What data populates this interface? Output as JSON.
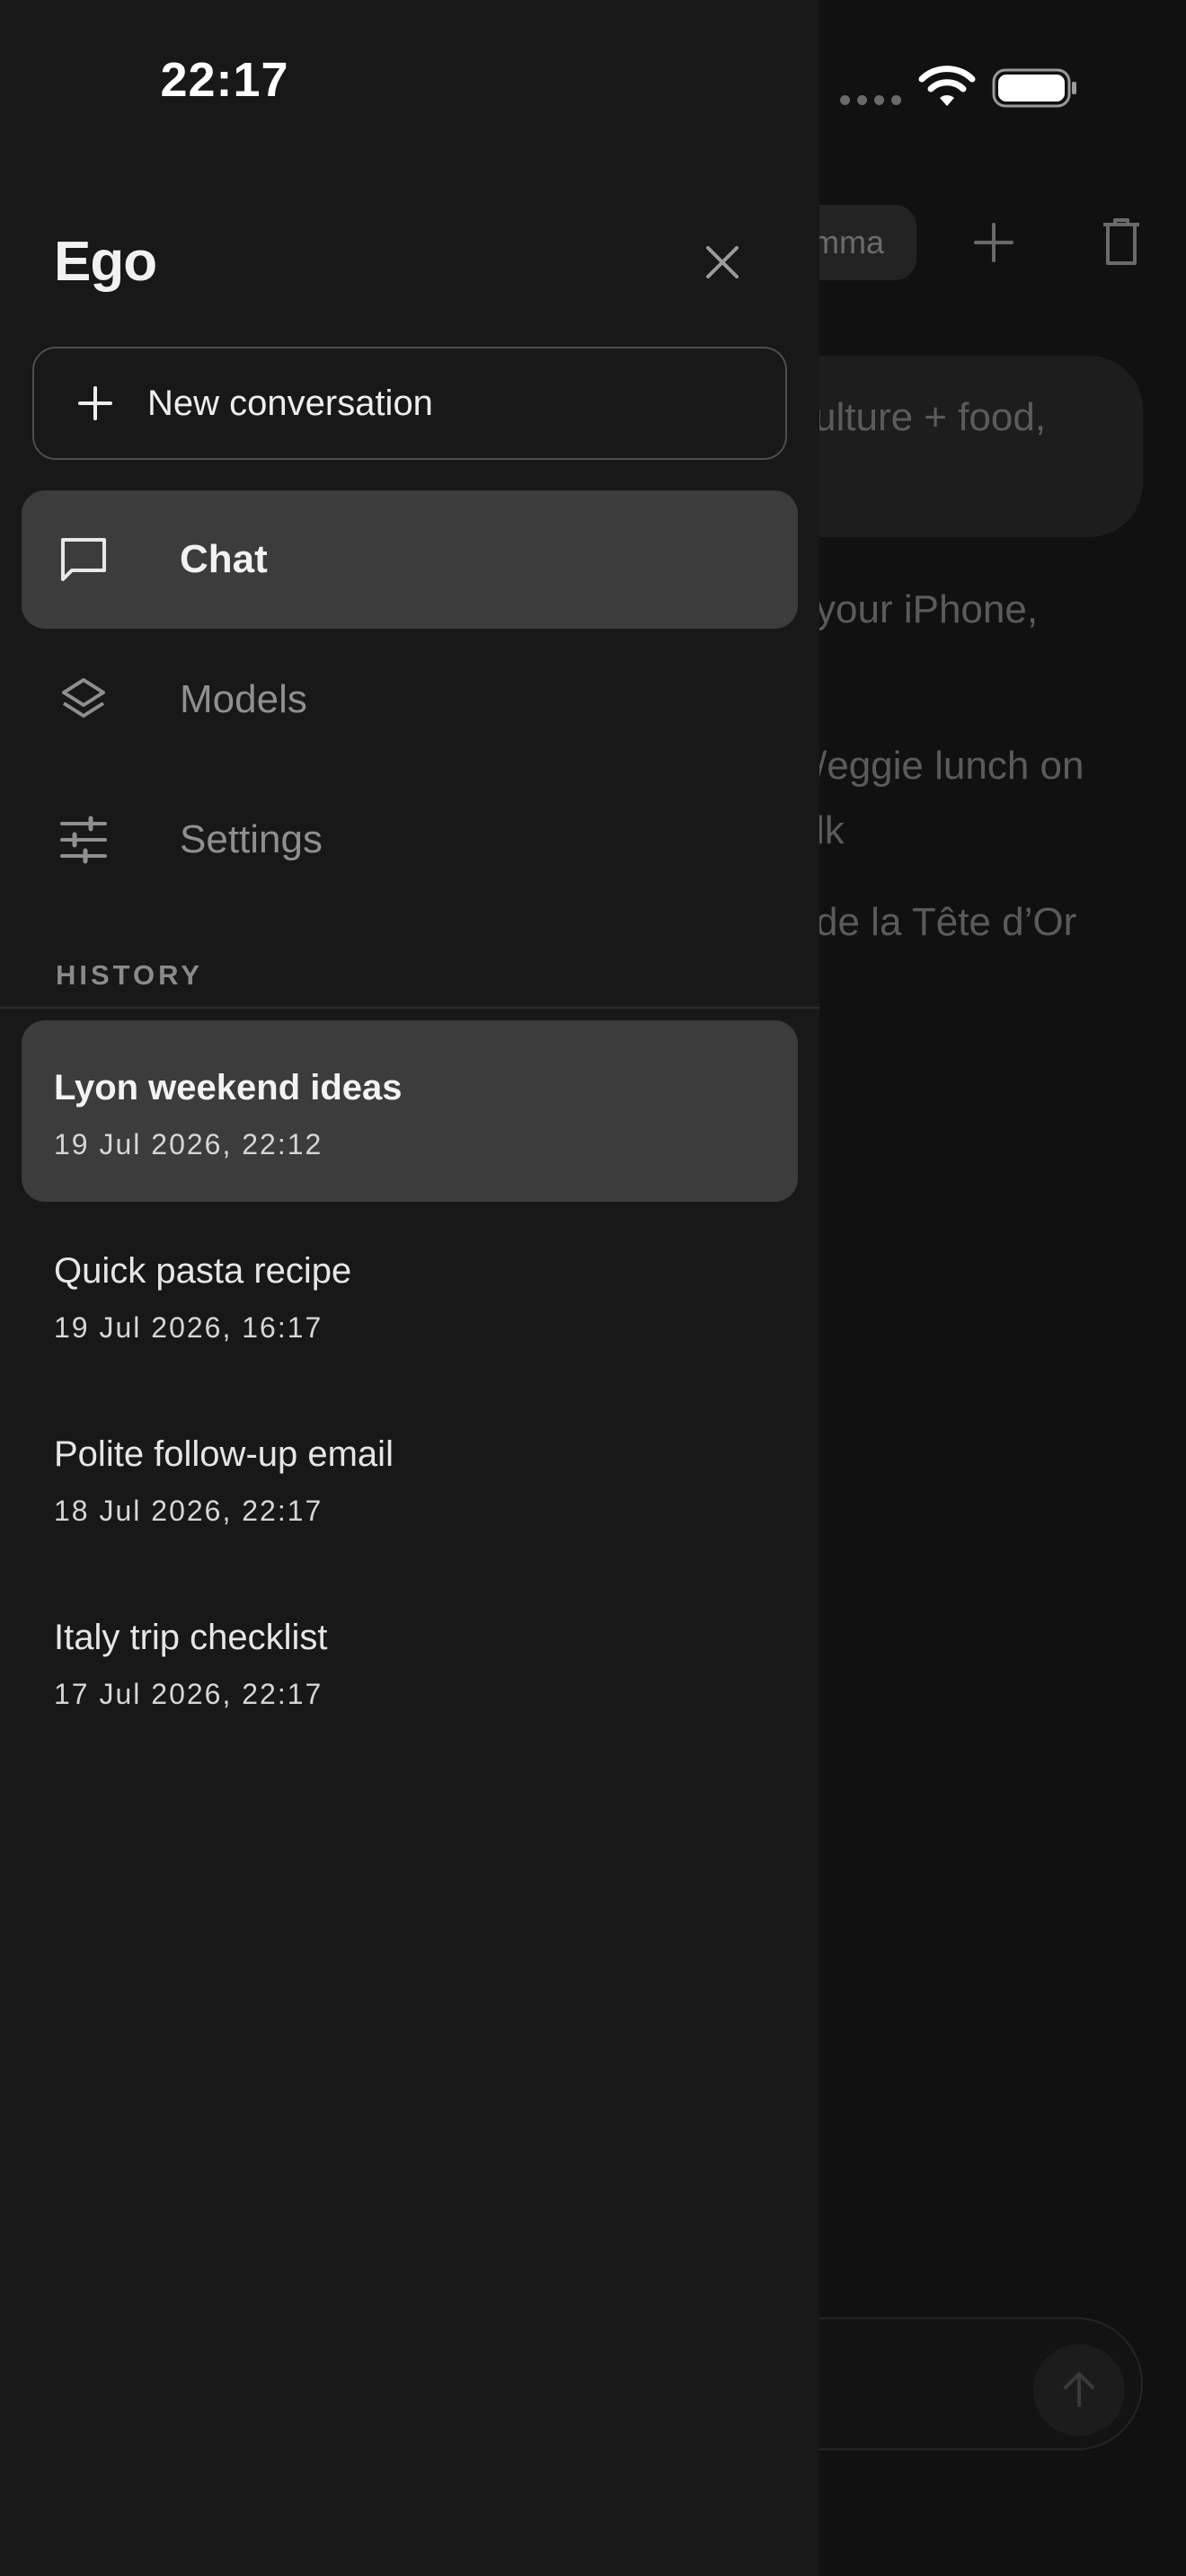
{
  "status_bar": {
    "time": "22:17"
  },
  "background_chat": {
    "model_chip_label": "mma",
    "user_message_fragment": "ulture + food,",
    "response_lines": [
      "your iPhone,",
      "/eggie lunch on",
      "lk",
      "de la Tête d’Or"
    ]
  },
  "drawer": {
    "title": "Ego",
    "new_conversation_label": "New conversation",
    "nav": [
      {
        "label": "Chat",
        "icon": "chat-bubble-icon",
        "active": true
      },
      {
        "label": "Models",
        "icon": "layers-icon",
        "active": false
      },
      {
        "label": "Settings",
        "icon": "sliders-icon",
        "active": false
      }
    ],
    "history_heading": "HISTORY",
    "history": [
      {
        "title": "Lyon weekend ideas",
        "date": "19 Jul 2026, 22:12",
        "active": true
      },
      {
        "title": "Quick pasta recipe",
        "date": "19 Jul 2026, 16:17",
        "active": false
      },
      {
        "title": "Polite follow-up email",
        "date": "18 Jul 2026, 22:17",
        "active": false
      },
      {
        "title": "Italy trip checklist",
        "date": "17 Jul 2026, 22:17",
        "active": false
      }
    ]
  },
  "colors": {
    "drawer_bg": "#181818",
    "active_item_bg": "#3c3c3c",
    "overlay_bg": "#111111"
  }
}
